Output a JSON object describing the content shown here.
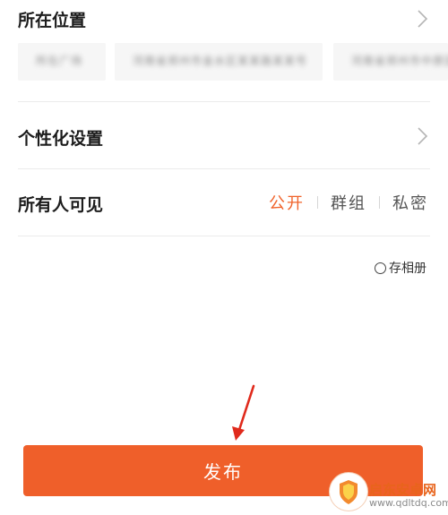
{
  "location": {
    "label": "所在位置",
    "chips": [
      "所在广场",
      "河南省郑州市金水区某某路某某号",
      "河南省郑州市中原区"
    ]
  },
  "personalize": {
    "label": "个性化设置"
  },
  "visibility": {
    "label": "所有人可见",
    "options": [
      "公开",
      "群组",
      "私密"
    ],
    "selected": "公开"
  },
  "save_album": {
    "label": "存相册"
  },
  "publish": {
    "label": "发布"
  },
  "watermark": {
    "title": "启东安卓网",
    "url": "www.qdltdq.com"
  },
  "colors": {
    "accent": "#ef5f2a",
    "active_text": "#f0632b"
  }
}
